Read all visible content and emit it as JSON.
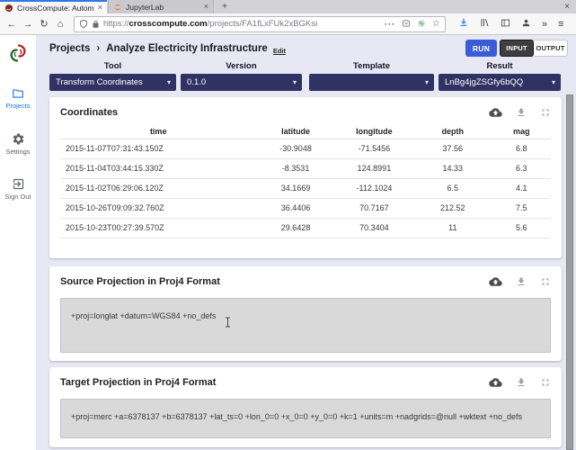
{
  "browser": {
    "tabs": [
      {
        "title": "CrossCompute: Automat",
        "close": "×"
      },
      {
        "title": "JupyterLab",
        "close": "×"
      }
    ],
    "new_tab": "+",
    "window_close": "×",
    "nav": {
      "back": "←",
      "forward": "→",
      "reload": "↻",
      "home": "⌂"
    },
    "address": {
      "scheme": "https://",
      "domain": "crosscompute.com",
      "path": "/projects/FA1fLxFUk2xBGKsi",
      "overflow_dots": "···",
      "bookmark_star": "☆"
    },
    "toolbar": {
      "more_tools": "»",
      "menu": "≡"
    }
  },
  "sidebar": {
    "items": [
      {
        "label": "Projects"
      },
      {
        "label": "Settings"
      },
      {
        "label": "Sign Out"
      }
    ]
  },
  "header": {
    "breadcrumb_root": "Projects",
    "separator": "›",
    "title": "Analyze Electricity Infrastructure",
    "edit_label": "Edit",
    "run_label": "RUN",
    "input_label": "INPUT",
    "output_label": "OUTPUT"
  },
  "ui": {
    "select_caret": "▾"
  },
  "selectors": [
    {
      "label": "Tool",
      "value": "Transform Coordinates"
    },
    {
      "label": "Version",
      "value": "0.1.0"
    },
    {
      "label": "Template",
      "value": ""
    },
    {
      "label": "Result",
      "value": "LnBg4jgZSGfy6bQQ"
    }
  ],
  "coordinates": {
    "title": "Coordinates",
    "columns": [
      "time",
      "latitude",
      "longitude",
      "depth",
      "mag"
    ],
    "rows": [
      [
        "2015-11-07T07:31:43.150Z",
        "-30.9048",
        "-71.5456",
        "37.56",
        "6.8"
      ],
      [
        "2015-11-04T03:44:15.330Z",
        "-8.3531",
        "124.8991",
        "14.33",
        "6.3"
      ],
      [
        "2015-11-02T06:29:06.120Z",
        "34.1669",
        "-112.1024",
        "6.5",
        "4.1"
      ],
      [
        "2015-10-26T09:09:32.760Z",
        "36.4406",
        "70.7167",
        "212.52",
        "7.5"
      ],
      [
        "2015-10-23T00:27:39.570Z",
        "29.6428",
        "70.3404",
        "11",
        "5.6"
      ]
    ]
  },
  "source_projection": {
    "title": "Source Projection in Proj4 Format",
    "value": "+proj=longlat +datum=WGS84 +no_defs"
  },
  "target_projection": {
    "title": "Target Projection in Proj4 Format",
    "value": "+proj=merc +a=6378137 +b=6378137 +lat_ts=0 +lon_0=0 +x_0=0 +y_0=0 +k=1 +units=m +nadgrids=@null +wktext +no_defs"
  },
  "colors": {
    "accent_blue": "#3b5cd6",
    "select_navy": "#2f3263",
    "active_link": "#1a73e8"
  }
}
